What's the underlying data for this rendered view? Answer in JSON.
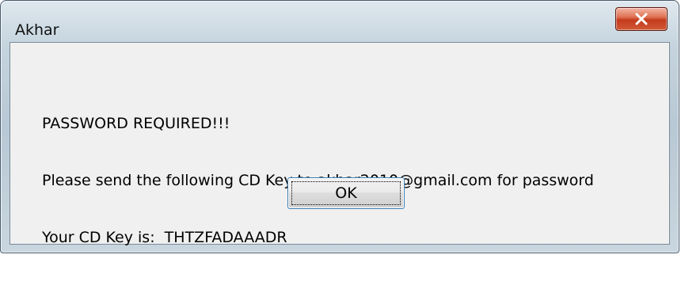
{
  "window": {
    "title": "Akhar",
    "close_icon": "close-x-icon"
  },
  "message": {
    "line1": "PASSWORD REQUIRED!!!",
    "line2": "Please send the following CD Key to akhar2010@gmail.com for password",
    "line3": "Your CD Key is:  THTZFADAAADR"
  },
  "buttons": {
    "ok_label": "OK"
  },
  "colors": {
    "close_button": "#c43b1c",
    "client_background": "#f0f0f0",
    "ok_border": "#3c7fb1"
  }
}
